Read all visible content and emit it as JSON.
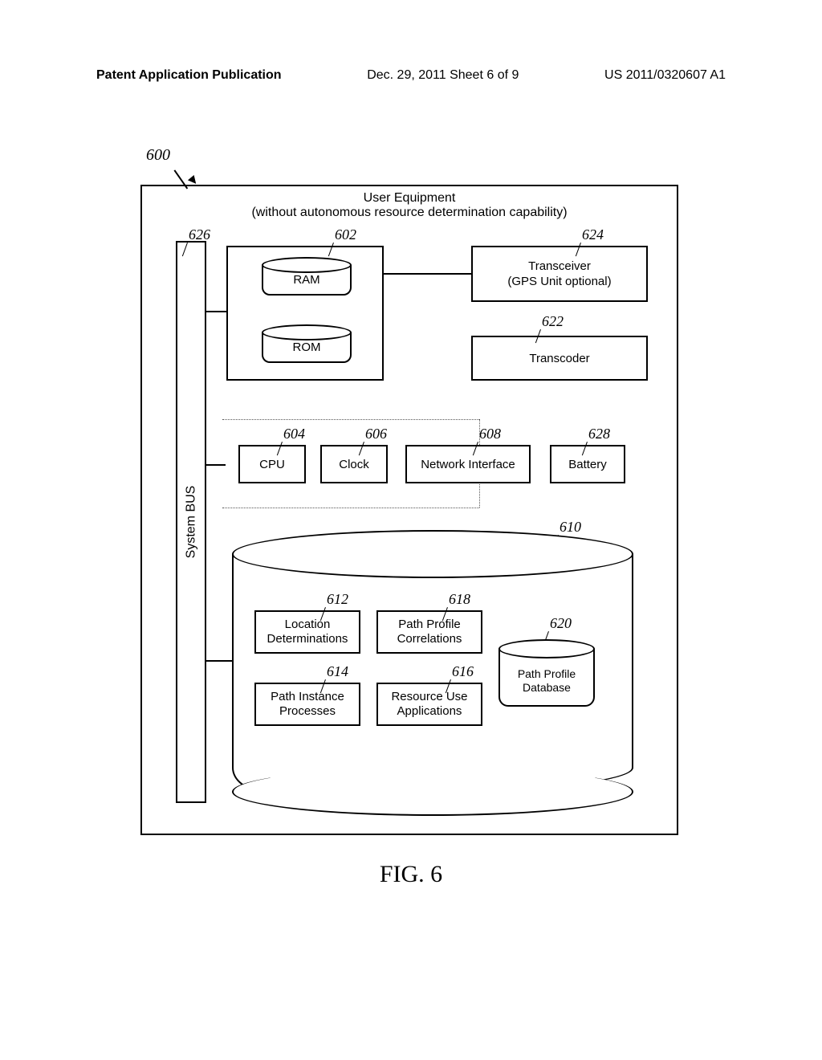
{
  "header": {
    "left": "Patent Application Publication",
    "center": "Dec. 29, 2011  Sheet 6 of 9",
    "right": "US 2011/0320607 A1"
  },
  "diagram": {
    "ref_main": "600",
    "title": "User Equipment",
    "subtitle": "(without autonomous resource determination capability)",
    "bus": "System BUS",
    "ram": "RAM",
    "rom": "ROM",
    "transceiver_l1": "Transceiver",
    "transceiver_l2": "(GPS Unit optional)",
    "transcoder": "Transcoder",
    "cpu": "CPU",
    "clock": "Clock",
    "netif": "Network Interface",
    "battery": "Battery",
    "loc_l1": "Location",
    "loc_l2": "Determinations",
    "pathprof_l1": "Path Profile",
    "pathprof_l2": "Correlations",
    "pathinst_l1": "Path Instance",
    "pathinst_l2": "Processes",
    "resuse_l1": "Resource Use",
    "resuse_l2": "Applications",
    "ppdb_l1": "Path Profile",
    "ppdb_l2": "Database"
  },
  "refs": {
    "r602": "602",
    "r604": "604",
    "r606": "606",
    "r608": "608",
    "r610": "610",
    "r612": "612",
    "r614": "614",
    "r616": "616",
    "r618": "618",
    "r620": "620",
    "r622": "622",
    "r624": "624",
    "r626": "626",
    "r628": "628"
  },
  "figure": "FIG. 6"
}
